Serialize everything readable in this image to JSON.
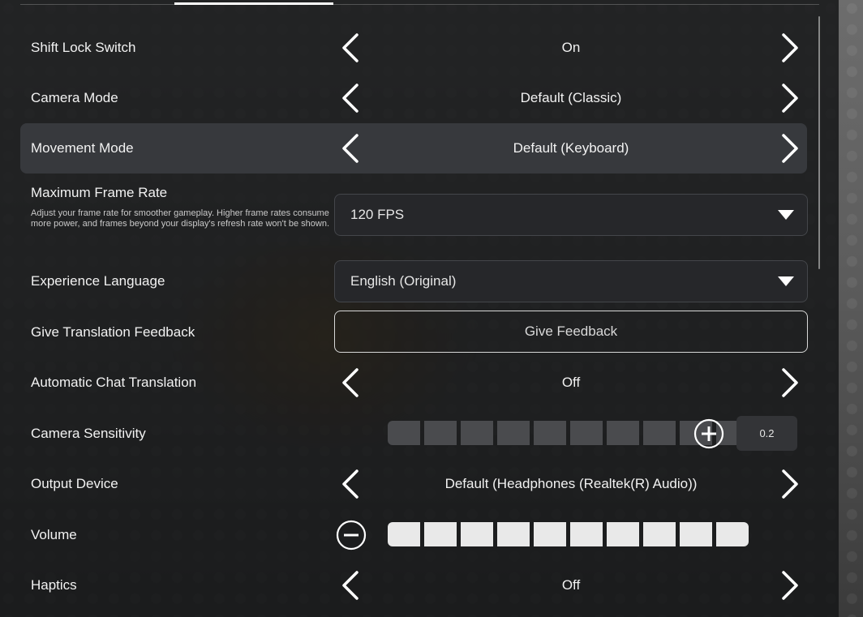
{
  "settings": {
    "shift_lock": {
      "label": "Shift Lock Switch",
      "value": "On"
    },
    "camera_mode": {
      "label": "Camera Mode",
      "value": "Default (Classic)"
    },
    "movement_mode": {
      "label": "Movement Mode",
      "value": "Default (Keyboard)"
    },
    "frame_rate": {
      "label": "Maximum Frame Rate",
      "description": "Adjust your frame rate for smoother gameplay. Higher frame rates consume more power, and frames beyond your display's refresh rate won't be shown.",
      "value": "120 FPS"
    },
    "language": {
      "label": "Experience Language",
      "value": "English (Original)"
    },
    "translation_feedback": {
      "label": "Give Translation Feedback",
      "button": "Give Feedback"
    },
    "chat_translation": {
      "label": "Automatic Chat Translation",
      "value": "Off"
    },
    "camera_sensitivity": {
      "label": "Camera Sensitivity",
      "value": "0.2",
      "filled_segments": 0,
      "total_segments": 10
    },
    "output_device": {
      "label": "Output Device",
      "value": "Default (Headphones (Realtek(R) Audio))"
    },
    "volume": {
      "label": "Volume",
      "filled_segments": 10,
      "total_segments": 10
    },
    "haptics": {
      "label": "Haptics",
      "value": "Off"
    }
  },
  "icons": {
    "arrow_left": "chevron-left-icon",
    "arrow_right": "chevron-right-icon",
    "plus": "plus-circle-icon",
    "minus": "minus-circle-icon",
    "caret": "caret-down-icon"
  },
  "colors": {
    "panel_bg": "#16171a",
    "highlight_row": "#3a3c40",
    "segment_on": "#e9e9e9",
    "segment_off": "#4a4b4e"
  }
}
